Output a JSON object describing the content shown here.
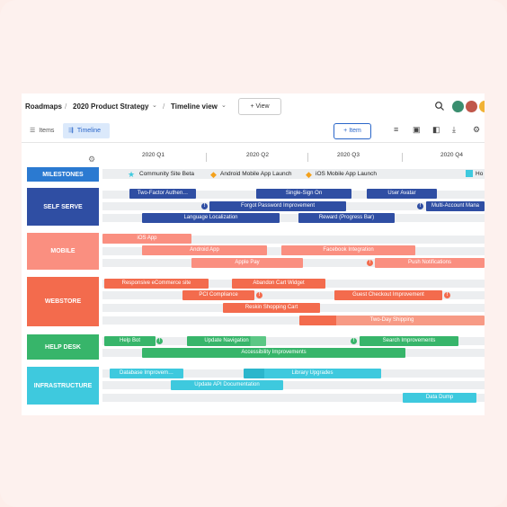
{
  "breadcrumb": {
    "root": "Roadmaps",
    "strategy": "2020 Product Strategy",
    "view": "Timeline view"
  },
  "view_button": "+ View",
  "toolbar": {
    "items_tab": "Items",
    "timeline_tab": "Timeline",
    "item_button": "+ Item"
  },
  "quarters": [
    "2020 Q1",
    "2020 Q2",
    "2020 Q3",
    "2020 Q4"
  ],
  "milestones": {
    "label": "MILESTONES",
    "items": [
      "Community Site Beta",
      "Android Mobile App Launch",
      "iOS Mobile App Launch",
      "Ho"
    ]
  },
  "colors": {
    "milestones": "#2b7ad1",
    "self_serve": "#2f4ea3",
    "mobile": "#fa8f80",
    "webstore": "#f36b4d",
    "help_desk": "#37b56a",
    "infrastructure": "#3ec9de"
  },
  "lanes": {
    "self_serve": {
      "label": "SELF SERVE",
      "bars": [
        "Two-Factor Authen…",
        "Single-Sign On",
        "User Avatar",
        "Forgot Password Improvement",
        "Multi-Account Mana",
        "Language Localization",
        "Reward (Progress Bar)"
      ]
    },
    "mobile": {
      "label": "MOBILE",
      "bars": [
        "iOS App",
        "Android App",
        "Facebook Integration",
        "Apple Pay",
        "Push Notifications"
      ]
    },
    "webstore": {
      "label": "WEBSTORE",
      "bars": [
        "Responsive eCommerce site",
        "Abandon Cart Widget",
        "PCI Compliance",
        "Guest Checkout Improvement",
        "Reskin Shopping Cart",
        "Two-Day Shipping"
      ]
    },
    "help_desk": {
      "label": "HELP DESK",
      "bars": [
        "Help Bot",
        "Update Navigation",
        "Search Improvements",
        "Accessibility Improvements"
      ]
    },
    "infrastructure": {
      "label": "INFRASTRUCTURE",
      "bars": [
        "Database Improvem…",
        "Library Upgrades",
        "Update API Documentation",
        "Data Dump"
      ]
    }
  }
}
